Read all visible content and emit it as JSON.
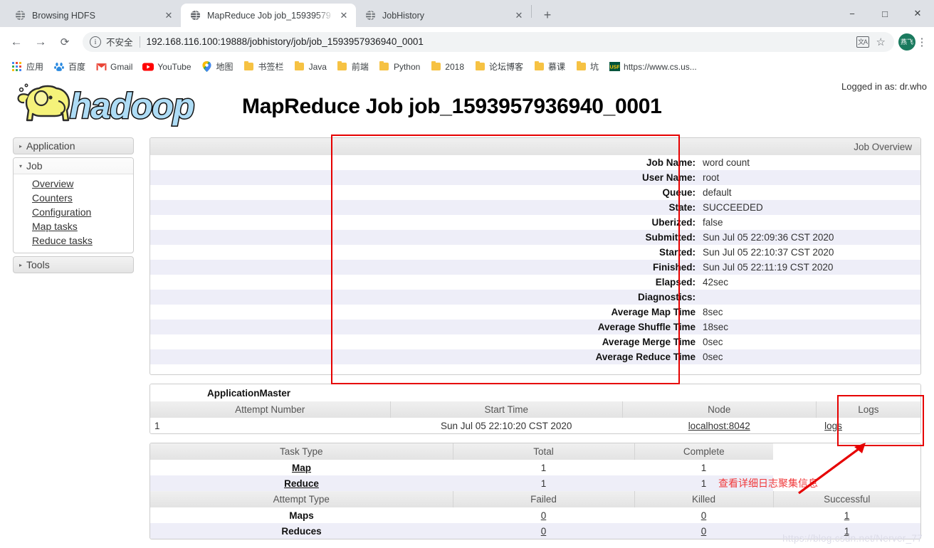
{
  "browser": {
    "tabs": [
      {
        "title": "Browsing HDFS",
        "active": false
      },
      {
        "title": "MapReduce Job job_15939579",
        "active": true
      },
      {
        "title": "JobHistory",
        "active": false
      }
    ],
    "newtab_label": "+",
    "window_controls": {
      "minimize": "−",
      "maximize": "□",
      "close": "✕"
    },
    "nav": {
      "back": "←",
      "forward": "→",
      "reload": "⟳"
    },
    "omnibox": {
      "info_glyph": "i",
      "security_text": "不安全",
      "url": "192.168.116.100:19888/jobhistory/job/job_1593957936940_0001",
      "translate_label": "文A",
      "star": "☆",
      "profile_initials": "燕飞",
      "menu": "⋮"
    },
    "bookmarks": [
      {
        "label": "应用",
        "icon": "apps-grid-icon"
      },
      {
        "label": "百度",
        "icon": "baidu-icon"
      },
      {
        "label": "Gmail",
        "icon": "gmail-icon"
      },
      {
        "label": "YouTube",
        "icon": "youtube-icon"
      },
      {
        "label": "地图",
        "icon": "maps-pin-icon"
      },
      {
        "label": "书签栏",
        "icon": "folder-icon"
      },
      {
        "label": "Java",
        "icon": "folder-icon"
      },
      {
        "label": "前端",
        "icon": "folder-icon"
      },
      {
        "label": "Python",
        "icon": "folder-icon"
      },
      {
        "label": "2018",
        "icon": "folder-icon"
      },
      {
        "label": "论坛博客",
        "icon": "folder-icon"
      },
      {
        "label": "慕课",
        "icon": "folder-icon"
      },
      {
        "label": "坑",
        "icon": "folder-icon"
      },
      {
        "label": "https://www.cs.us...",
        "icon": "usf-icon"
      }
    ]
  },
  "page": {
    "logged_in_as": "Logged in as: dr.who",
    "title": "MapReduce Job job_1593957936940_0001",
    "logo_text": "hadoop",
    "watermark": "https://blog.csdn.net/Nerver_77"
  },
  "sidebar": {
    "application": {
      "label": "Application",
      "caret": "▸"
    },
    "job": {
      "label": "Job",
      "caret": "▾",
      "links": [
        "Overview",
        "Counters",
        "Configuration",
        "Map tasks",
        "Reduce tasks"
      ]
    },
    "tools": {
      "label": "Tools",
      "caret": "▸"
    }
  },
  "job_overview": {
    "panel_title": "Job Overview",
    "rows": [
      {
        "key": "Job Name:",
        "value": "word count"
      },
      {
        "key": "User Name:",
        "value": "root"
      },
      {
        "key": "Queue:",
        "value": "default"
      },
      {
        "key": "State:",
        "value": "SUCCEEDED"
      },
      {
        "key": "Uberized:",
        "value": "false"
      },
      {
        "key": "Submitted:",
        "value": "Sun Jul 05 22:09:36 CST 2020"
      },
      {
        "key": "Started:",
        "value": "Sun Jul 05 22:10:37 CST 2020"
      },
      {
        "key": "Finished:",
        "value": "Sun Jul 05 22:11:19 CST 2020"
      },
      {
        "key": "Elapsed:",
        "value": "42sec"
      },
      {
        "key": "Diagnostics:",
        "value": ""
      },
      {
        "key": "Average Map Time",
        "value": "8sec"
      },
      {
        "key": "Average Shuffle Time",
        "value": "18sec"
      },
      {
        "key": "Average Merge Time",
        "value": "0sec"
      },
      {
        "key": "Average Reduce Time",
        "value": "0sec"
      }
    ]
  },
  "application_master": {
    "section_label": "ApplicationMaster",
    "headers": [
      "Attempt Number",
      "Start Time",
      "Node",
      "Logs"
    ],
    "row": {
      "attempt_number": "1",
      "start_time": "Sun Jul 05 22:10:20 CST 2020",
      "node": "localhost:8042",
      "logs": "logs"
    }
  },
  "task_summary": {
    "task_headers": [
      "Task Type",
      "Total",
      "Complete"
    ],
    "task_rows": [
      {
        "type": "Map",
        "total": "1",
        "complete": "1"
      },
      {
        "type": "Reduce",
        "total": "1",
        "complete": "1"
      }
    ],
    "attempt_headers": [
      "Attempt Type",
      "Failed",
      "Killed",
      "Successful"
    ],
    "attempt_rows": [
      {
        "type": "Maps",
        "failed": "0",
        "killed": "0",
        "successful": "1"
      },
      {
        "type": "Reduces",
        "failed": "0",
        "killed": "0",
        "successful": "1"
      }
    ]
  },
  "annotations": {
    "note_logs": "查看详细日志聚集信息"
  },
  "colors": {
    "annotation_red": "#e60000",
    "note_text": "#f0393b",
    "alt_row": "#eeeef8",
    "header_gray": "#e3e3e3"
  }
}
